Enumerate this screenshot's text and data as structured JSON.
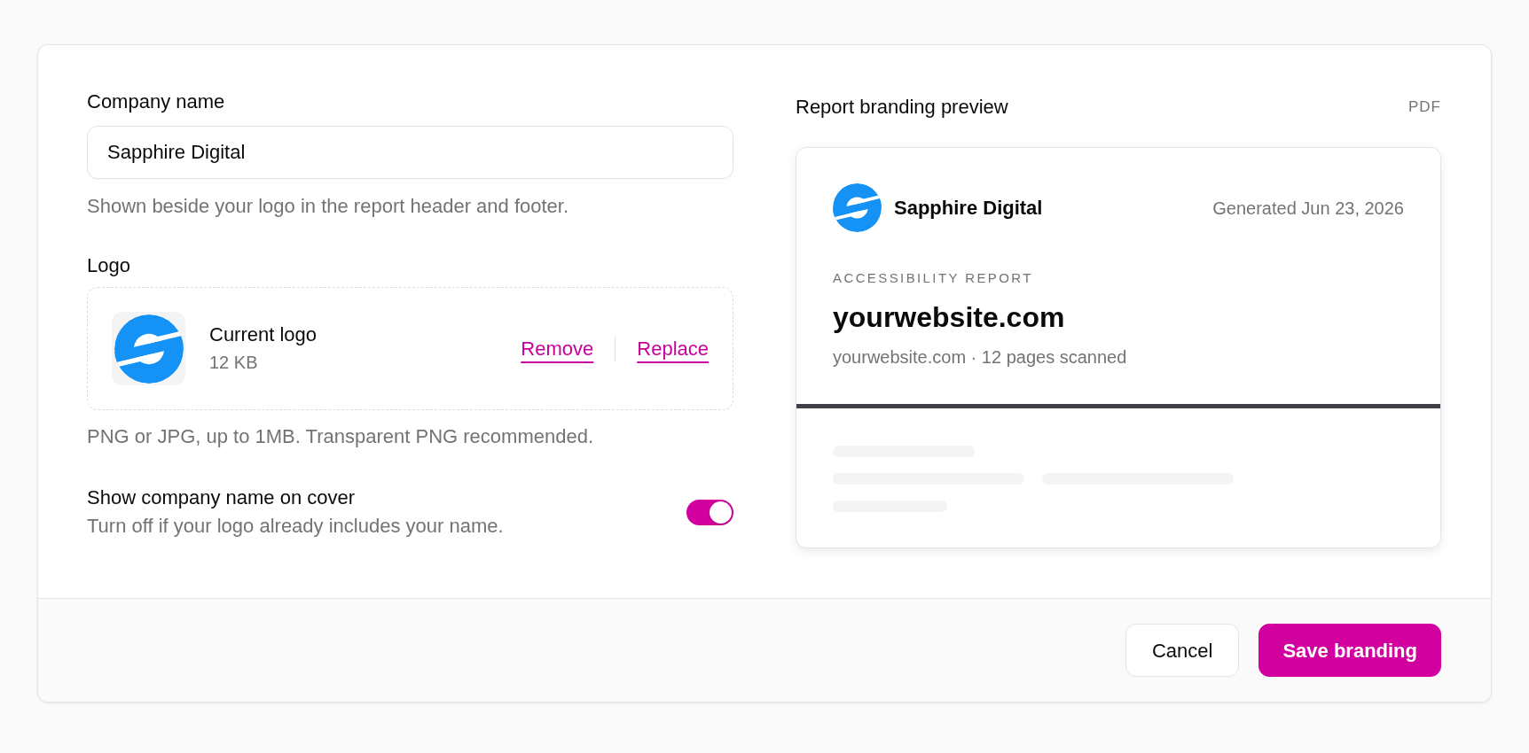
{
  "form": {
    "company_name": {
      "label": "Company name",
      "value": "Sapphire Digital",
      "hint": "Shown beside your logo in the report header and footer."
    },
    "logo": {
      "label": "Logo",
      "file_title": "Current logo",
      "file_size": "12 KB",
      "actions": [
        "Remove",
        "Replace"
      ],
      "hint": "PNG or JPG, up to 1MB. Transparent PNG recommended."
    },
    "show_name_on_cover": {
      "label": "Show company name on cover",
      "description": "Turn off if your logo already includes your name.",
      "on": true
    }
  },
  "preview": {
    "title": "Report branding preview",
    "format": "PDF",
    "report": {
      "company": "Sapphire Digital",
      "generated": "Generated Jun 23, 2026",
      "eyebrow": "ACCESSIBILITY REPORT",
      "site": "yourwebsite.com",
      "summary": "yourwebsite.com · 12 pages scanned"
    }
  },
  "footer": {
    "buttons": [
      {
        "label": "Cancel",
        "kind": "secondary"
      },
      {
        "label": "Save branding",
        "kind": "primary"
      }
    ]
  }
}
